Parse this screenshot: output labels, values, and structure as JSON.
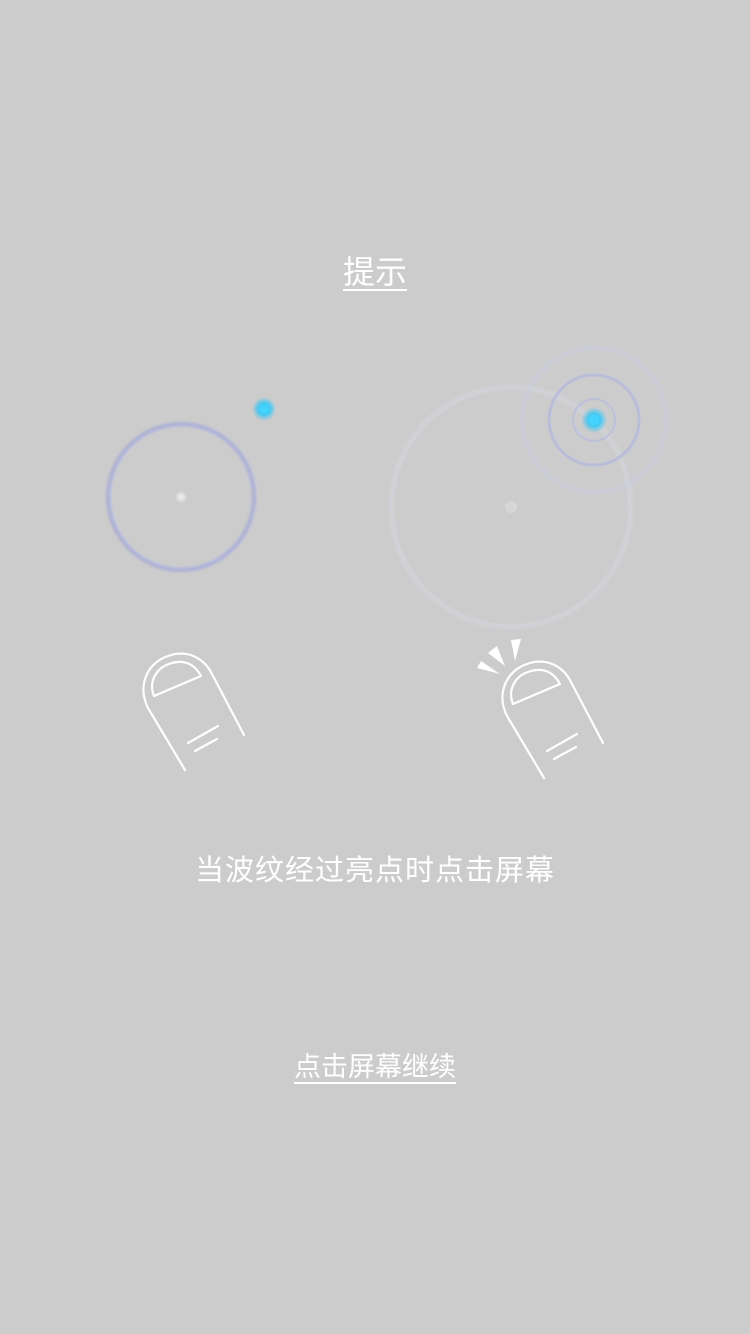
{
  "tutorial": {
    "title": "提示",
    "instruction": "当波纹经过亮点时点击屏幕",
    "continue_label": "点击屏幕继续"
  },
  "icons": {
    "left_ripple": "ripple-ring-icon",
    "left_target": "glowing-dot-icon",
    "left_hand": "finger-tap-icon",
    "right_ripple": "faded-ripple-ring-icon",
    "right_target": "glowing-dot-burst-icon",
    "right_hand": "finger-tap-burst-icon"
  },
  "colors": {
    "background": "#cccccc",
    "text": "#ffffff",
    "ripple": "#a9aed6",
    "glow_dot": "#35c7f5"
  }
}
